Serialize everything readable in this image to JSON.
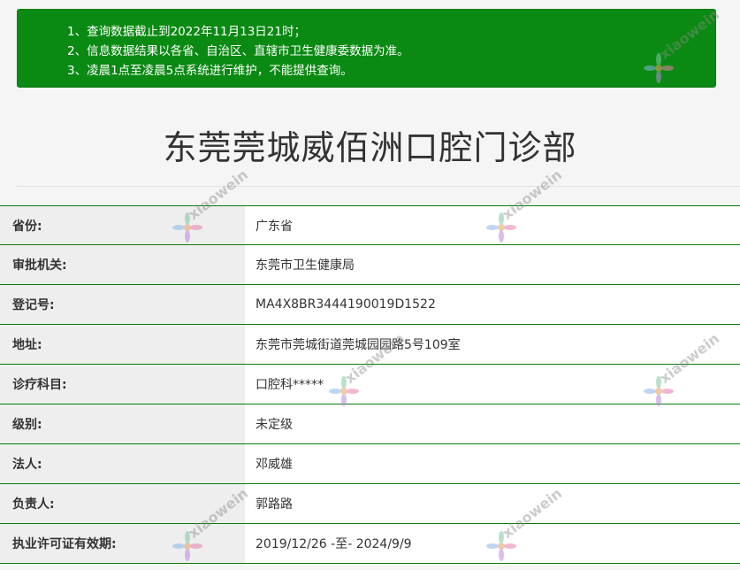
{
  "notice": {
    "lines": [
      "1、查询数据截止到2022年11月13日21时；",
      "2、信息数据结果以各省、自治区、直辖市卫生健康委数据为准。",
      "3、凌晨1点至凌晨5点系统进行维护，不能提供查询。"
    ]
  },
  "title": "东莞莞城威佰洲口腔门诊部",
  "rows": [
    {
      "label": "省份:",
      "value": "广东省"
    },
    {
      "label": "审批机关:",
      "value": "东莞市卫生健康局"
    },
    {
      "label": "登记号:",
      "value": "MA4X8BR3444190019D1522"
    },
    {
      "label": "地址:",
      "value": "东莞市莞城街道莞城园园路5号109室"
    },
    {
      "label": "诊疗科目:",
      "value": "口腔科*****"
    },
    {
      "label": "级别:",
      "value": "未定级"
    },
    {
      "label": "法人:",
      "value": "邓威雄"
    },
    {
      "label": "负责人:",
      "value": "郭路路"
    },
    {
      "label": "执业许可证有效期:",
      "value": "2019/12/26 -至- 2024/9/9"
    }
  ],
  "watermark": {
    "text": "xiaowein"
  },
  "colors": {
    "notice_bg": "#0a8a12",
    "divider": "#0b7a10",
    "label_bg": "#eeeeee"
  }
}
